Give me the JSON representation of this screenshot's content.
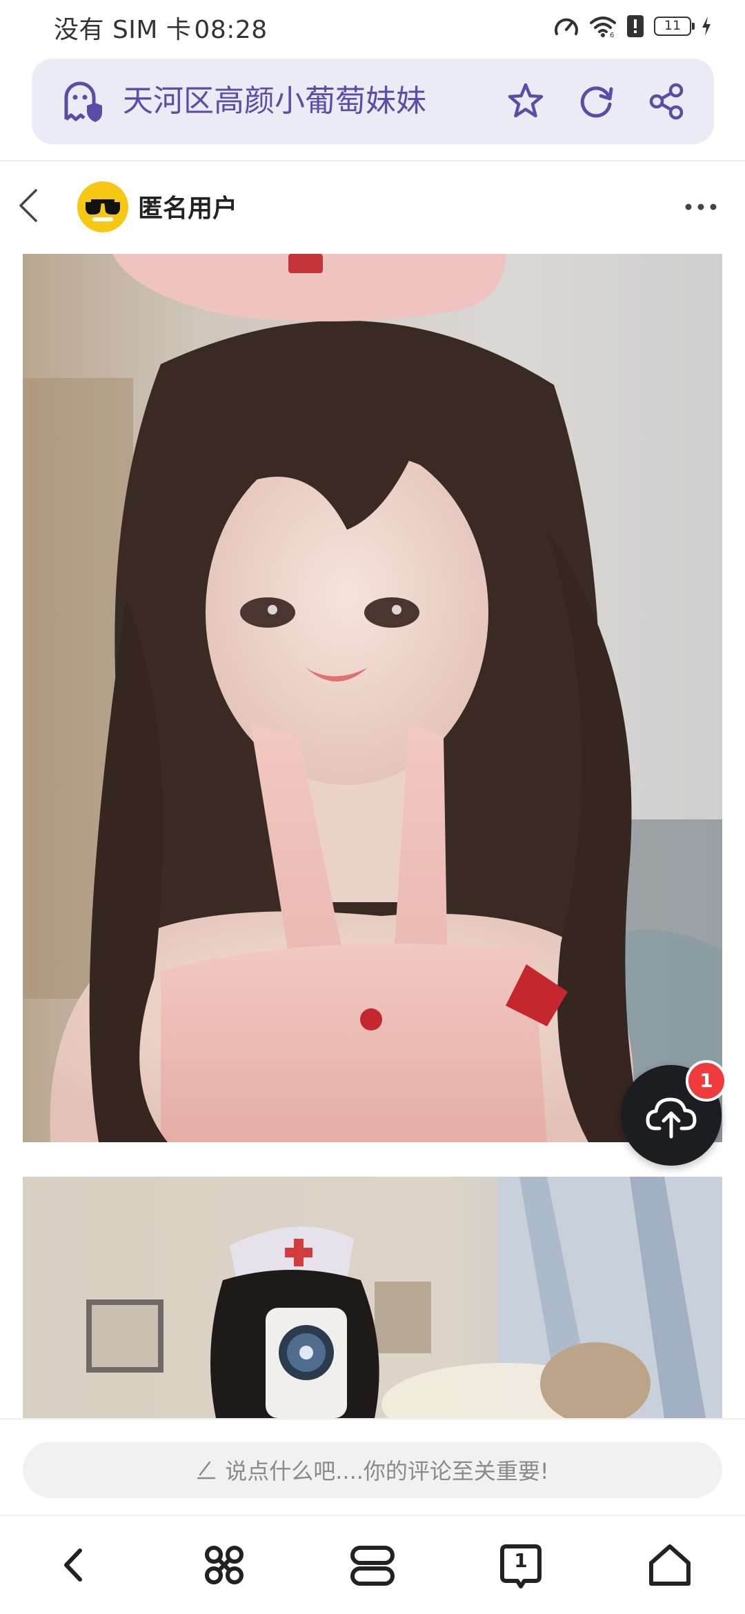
{
  "status_bar": {
    "carrier": "没有 SIM 卡",
    "time": "08:28",
    "battery": "11",
    "icons": [
      "speed-icon",
      "wifi-icon",
      "alert-icon",
      "battery-icon",
      "charging-icon"
    ]
  },
  "address_bar": {
    "title": "天河区高颜小葡萄妹妹",
    "icons": [
      "ghost-shield-icon",
      "star-icon",
      "refresh-icon",
      "share-icon"
    ]
  },
  "post": {
    "author": "匿名用户",
    "icons": [
      "back-icon",
      "avatar",
      "more-icon"
    ]
  },
  "upload": {
    "badge": "1",
    "icon": "cloud-upload-icon"
  },
  "comment": {
    "placeholder": "说点什么吧....你的评论至关重要!",
    "icon": "pen-icon"
  },
  "bottom_nav": {
    "icons": [
      "back-icon",
      "features-icon",
      "tabs-icon",
      "tab-count-icon",
      "home-icon"
    ],
    "tab_count": "1"
  },
  "colors": {
    "accent": "#5b4ca8",
    "address_bg": "#ebebf5",
    "fab": "#1c1d20",
    "badge": "#ef3b3b"
  }
}
